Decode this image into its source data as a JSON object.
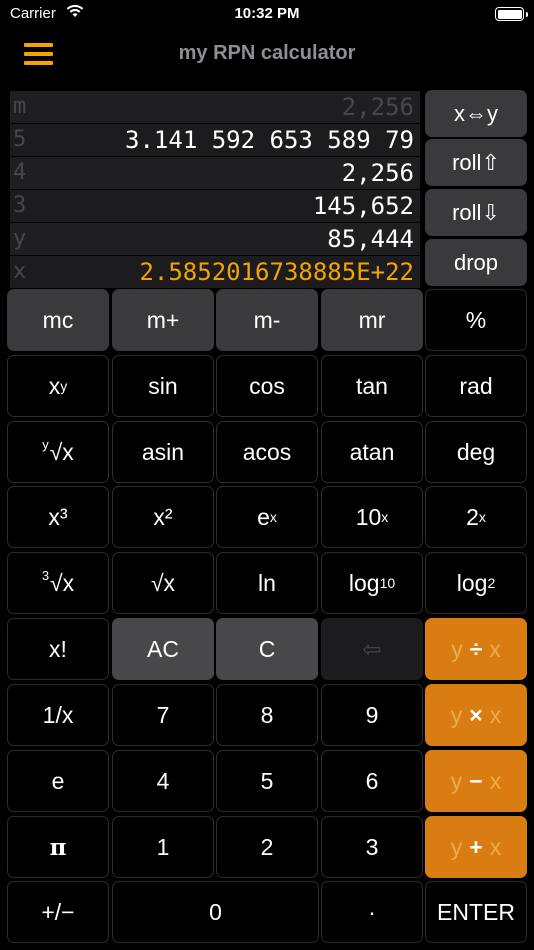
{
  "status_bar": {
    "carrier": "Carrier",
    "time": "10:32 PM"
  },
  "nav": {
    "title": "my RPN calculator",
    "menu_icon": "hamburger-menu-icon"
  },
  "stack": [
    {
      "label": "m",
      "value": "2,256"
    },
    {
      "label": "5",
      "value": "3.141 592 653 589 79"
    },
    {
      "label": "4",
      "value": "2,256"
    },
    {
      "label": "3",
      "value": "145,652"
    },
    {
      "label": "y",
      "value": "85,444"
    },
    {
      "label": "x",
      "value": "2.5852016738885E+22"
    }
  ],
  "stack_buttons": {
    "swap": "x⇔y",
    "roll_up": "roll⇧",
    "roll_down": "roll⇩",
    "drop": "drop"
  },
  "memory_keys": {
    "mc": "mc",
    "mplus": "m+",
    "mminus": "m-",
    "mr": "mr",
    "percent": "%"
  },
  "row_trig": {
    "pow_base": "x",
    "pow_exp": "y",
    "sin": "sin",
    "cos": "cos",
    "tan": "tan",
    "rad": "rad"
  },
  "row_atrig": {
    "root_index": "y",
    "root_sym": "√x",
    "asin": "asin",
    "acos": "acos",
    "atan": "atan",
    "deg": "deg"
  },
  "row_pow": {
    "cube": "x³",
    "square": "x²",
    "exp_base": "e",
    "exp_sup": "x",
    "ten_base": "10",
    "ten_sup": "x",
    "two_base": "2",
    "two_sup": "x"
  },
  "row_root": {
    "cbrt_index": "3",
    "cbrt_sym": "√x",
    "sqrt_sym": "√x",
    "ln": "ln",
    "log10_base": "log",
    "log10_sub": "10",
    "log2_base": "log",
    "log2_sub": "2"
  },
  "row_clear": {
    "fact": "x!",
    "ac": "AC",
    "c": "C",
    "backspace": "⇦",
    "div_y": "y",
    "div_sym": "÷",
    "div_x": "x"
  },
  "row_789": {
    "recip": "1/x",
    "k7": "7",
    "k8": "8",
    "k9": "9",
    "mul_y": "y",
    "mul_sym": "×",
    "mul_x": "x"
  },
  "row_456": {
    "e": "e",
    "k4": "4",
    "k5": "5",
    "k6": "6",
    "sub_y": "y",
    "sub_sym": "−",
    "sub_x": "x"
  },
  "row_123": {
    "pi": "π",
    "k1": "1",
    "k2": "2",
    "k3": "3",
    "add_y": "y",
    "add_sym": "+",
    "add_x": "x"
  },
  "row_0": {
    "sign": "+/−",
    "k0": "0",
    "dot": "·",
    "enter": "ENTER"
  },
  "colors": {
    "accent": "#f5a300",
    "operator_bg": "#d97d12",
    "memory_bg": "#3a3a3c"
  }
}
